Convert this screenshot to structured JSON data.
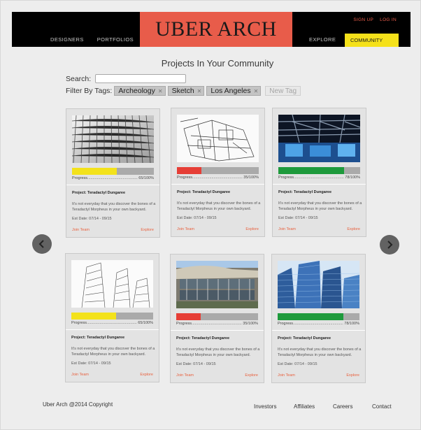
{
  "header": {
    "nav": [
      "DESIGNERS",
      "PORTFOLIOS"
    ],
    "logo": "UBER ARCH",
    "auth": [
      "SIGN UP",
      "LOG IN"
    ],
    "explore": "EXPLORE",
    "community": "COMMUNITY"
  },
  "main": {
    "title": "Projects In Your Community",
    "search_label": "Search:",
    "search_value": "",
    "filter_label": "Filter By Tags:",
    "tags": [
      "Archeology",
      "Sketch",
      "Los Angeles"
    ],
    "new_tag": "New Tag"
  },
  "cards": [
    {
      "progress_label": "Progress",
      "progress_text": "65/100%",
      "progress": 0.55,
      "bar_color": "#f3e21b",
      "title": "Project: Teradactyl Dungaree",
      "desc": "It's not everyday that you discover the bones of a Teradactyl Morpheus in your own backyard.",
      "date": "Est Date: 07/14 - 09/15",
      "join": "Join Team",
      "explore": "Explore",
      "image": "grid-ceiling"
    },
    {
      "progress_label": "Progress",
      "progress_text": "35/100%",
      "progress": 0.3,
      "bar_color": "#e63e36",
      "title": "Project: Teradactyl Dungaree",
      "desc": "It's not everyday that you discover the bones of a Teradactyl Morpheus in your own backyard.",
      "date": "Est Date: 07/14 - 09/15",
      "join": "Join Team",
      "explore": "Explore",
      "image": "floor-plan"
    },
    {
      "progress_label": "Progress",
      "progress_text": "78/100%",
      "progress": 0.8,
      "bar_color": "#1e9a3c",
      "title": "Project: Teradactyl Dungaree",
      "desc": "It's not everyday that you discover the bones of a Teradactyl Morpheus in your own backyard.",
      "date": "Est Date: 07/14 - 09/15",
      "join": "Join Team",
      "explore": "Explore",
      "image": "steel-hall"
    },
    {
      "progress_label": "Progress",
      "progress_text": "65/100%",
      "progress": 0.55,
      "bar_color": "#f3e21b",
      "title": "Project: Teradactyl Dungaree",
      "desc": "It's not everyday that you discover the bones of a Teradactyl Morpheus in your own backyard.",
      "date": "Est Date: 07/14 - 09/15",
      "join": "Join Team",
      "explore": "Explore",
      "image": "towers-sketch"
    },
    {
      "progress_label": "Progress",
      "progress_text": "35/100%",
      "progress": 0.3,
      "bar_color": "#e63e36",
      "title": "Project: Teradactyl Dungaree",
      "desc": "It's not everyday that you discover the bones of a Teradactyl Morpheus in your own backyard.",
      "date": "Est Date: 07/14 - 09/15",
      "join": "Join Team",
      "explore": "Explore",
      "image": "curved-building"
    },
    {
      "progress_label": "Progress",
      "progress_text": "78/100%",
      "progress": 0.8,
      "bar_color": "#1e9a3c",
      "title": "Project: Teradactyl Dungaree",
      "desc": "It's not everyday that you discover the bones of a Teradactyl Morpheus in your own backyard.",
      "date": "Est Date: 07/14 - 09/15",
      "join": "Join Team",
      "explore": "Explore",
      "image": "glass-towers"
    }
  ],
  "footer": {
    "copyright": "Uber Arch @2014 Copyright",
    "links": [
      "Investors",
      "Affiliates",
      "Careers",
      "Contact"
    ]
  }
}
